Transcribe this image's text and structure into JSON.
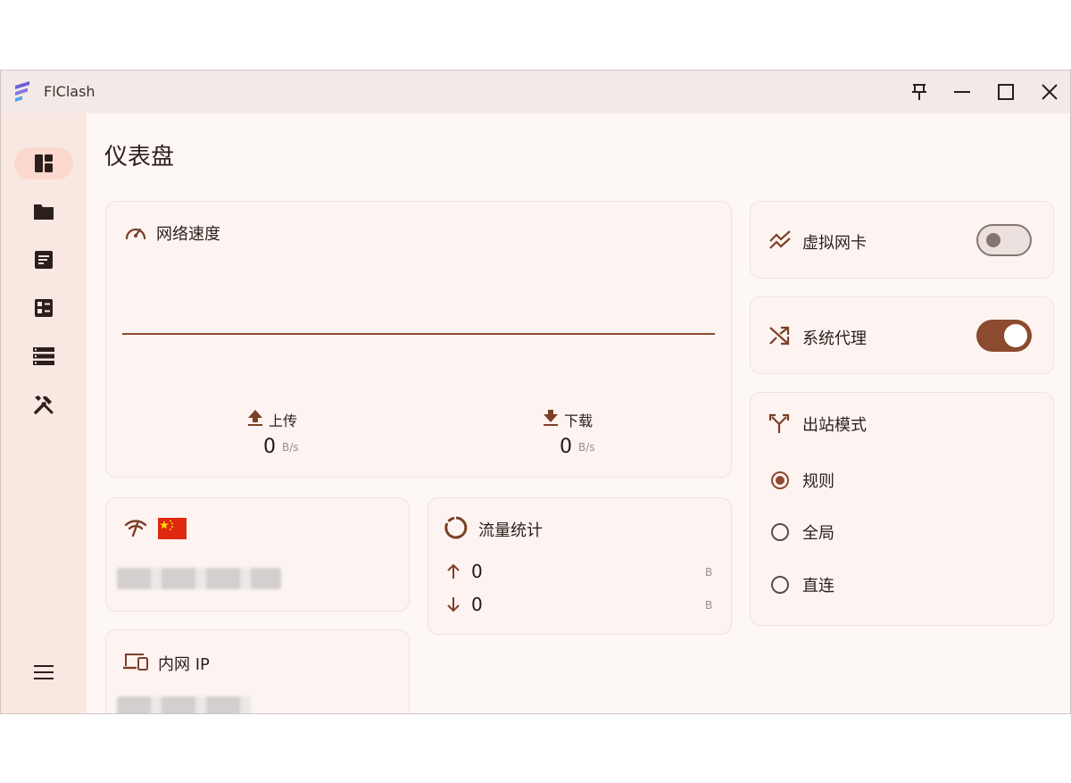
{
  "window": {
    "title": "FlClash"
  },
  "page": {
    "title": "仪表盘"
  },
  "sidebar": {
    "items": [
      {
        "icon": "dashboard-icon",
        "active": true
      },
      {
        "icon": "folder-icon"
      },
      {
        "icon": "document-icon"
      },
      {
        "icon": "grid-list-icon"
      },
      {
        "icon": "list-icon"
      },
      {
        "icon": "tools-icon"
      }
    ],
    "menu_icon": "hamburger-menu-icon"
  },
  "network_speed": {
    "title": "网络速度",
    "upload_label": "上传",
    "upload_value": "0",
    "upload_unit": "B/s",
    "download_label": "下载",
    "download_value": "0",
    "download_unit": "B/s"
  },
  "network_detection": {
    "icon": "signal-icon",
    "flag": "china-flag-icon"
  },
  "traffic_stats": {
    "title": "流量统计",
    "up_value": "0",
    "up_unit": "B",
    "down_value": "0",
    "down_unit": "B"
  },
  "intranet_ip": {
    "title": "内网 IP"
  },
  "tun": {
    "title": "虚拟网卡",
    "enabled": false
  },
  "system_proxy": {
    "title": "系统代理",
    "enabled": true
  },
  "outbound_mode": {
    "title": "出站模式",
    "options": [
      {
        "label": "规则",
        "selected": true
      },
      {
        "label": "全局",
        "selected": false
      },
      {
        "label": "直连",
        "selected": false
      }
    ]
  },
  "colors": {
    "accent": "#8c4a2f",
    "background": "#fdf7f5",
    "sidebar": "#f9e7e1",
    "active_nav": "#fbd8cd"
  }
}
